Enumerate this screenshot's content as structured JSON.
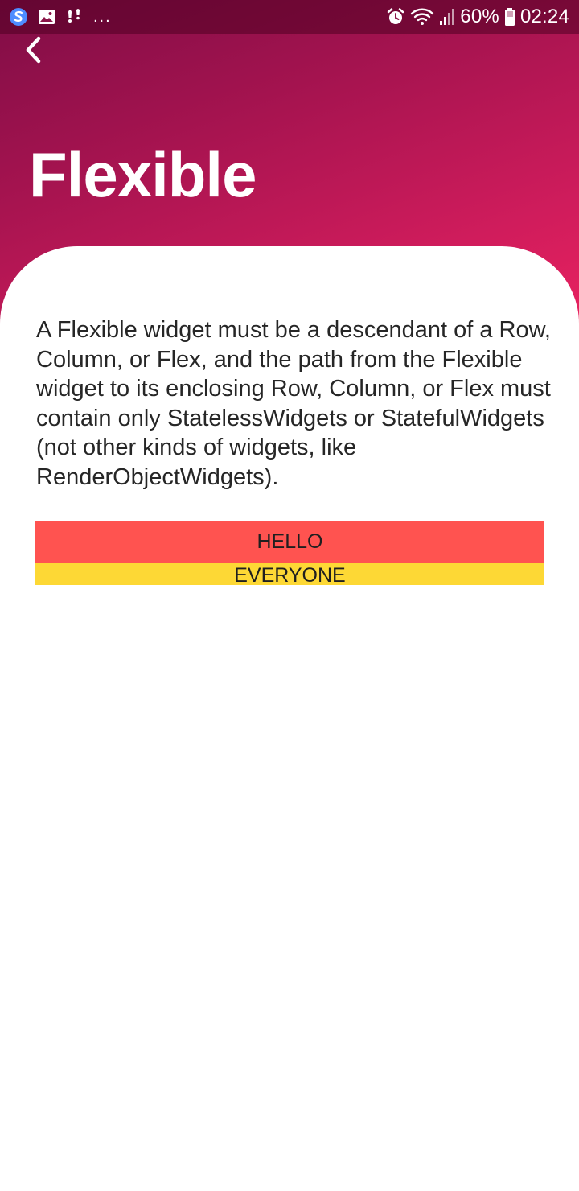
{
  "status_bar": {
    "battery_text": "60%",
    "time": "02:24",
    "icons": [
      "skype-icon",
      "gallery-icon",
      "notification-icon",
      "more-icon",
      "alarm-icon",
      "wifi-icon",
      "signal-icon",
      "battery-icon"
    ],
    "more_label": "..."
  },
  "header": {
    "title": "Flexible",
    "gradient_colors": [
      "#7f0d46",
      "#a4134f",
      "#d01c5c",
      "#ea225f"
    ]
  },
  "content": {
    "description": "A Flexible widget must be a descendant of a Row, Column, or Flex, and the path from the Flexible widget to its enclosing Row, Column, or Flex must contain only StatelessWidgets or StatefulWidgets (not other kinds of widgets, like RenderObjectWidgets).",
    "demo": {
      "top_label": "HELLO",
      "bottom_label": "EVERYONE",
      "top_color": "#ff5350",
      "bottom_color": "#fdd835"
    }
  }
}
